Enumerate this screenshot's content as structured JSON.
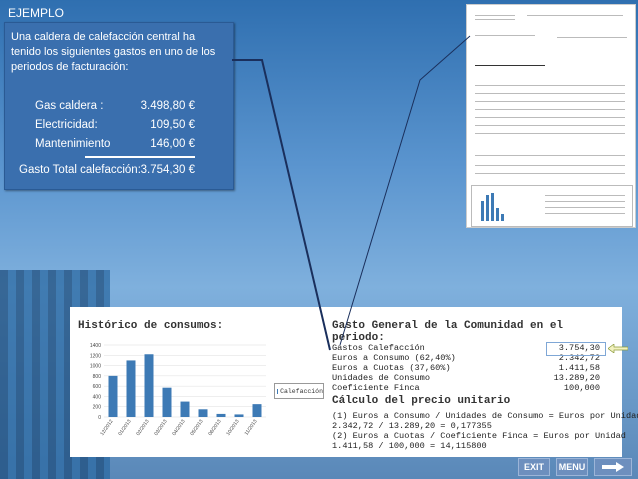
{
  "title": "EJEMPLO",
  "panel": {
    "description": "Una caldera de calefacción central ha tenido los siguientes gastos en uno de los periodos de facturación:",
    "items": [
      {
        "label": "Gas caldera :",
        "amount": "3.498,80 €"
      },
      {
        "label": "Electricidad:",
        "amount": "109,50 €"
      },
      {
        "label": "Mantenimiento",
        "amount": "146,00 €"
      }
    ],
    "total_label": "Gasto Total calefacción:",
    "total_amount": "3.754,30 €"
  },
  "detail": {
    "history_title": "Histórico de consumos:",
    "general_title": "Gasto General de la Comunidad en el periodo:",
    "general": [
      {
        "label": "Gastos Calefacción",
        "value": "3.754,30"
      },
      {
        "label": "Euros a Consumo (62,40%)",
        "value": "2.342,72"
      },
      {
        "label": "Euros a Cuotas (37,60%)",
        "value": "1.411,58"
      },
      {
        "label": "Unidades de Consumo",
        "value": "13.289,20"
      },
      {
        "label": "Coeficiente Finca",
        "value": "100,000"
      }
    ],
    "calc_title": "Cálculo del precio unitario",
    "formula1": "(1) Euros a Consumo / Unidades de Consumo = Euros por Unidad",
    "result1": "2.342,72 / 13.289,20 = 0,177355",
    "formula2": "(2) Euros a Cuotas / Coeficiente Finca = Euros por Unidad",
    "result2": "1.411,58 / 100,000 = 14,115800"
  },
  "chart_data": {
    "type": "bar",
    "categories": [
      "12/2012",
      "01/2013",
      "02/2013",
      "03/2013",
      "04/2013",
      "05/2013",
      "06/2013",
      "10/2013",
      "11/2013"
    ],
    "series": [
      {
        "name": "Calefacción",
        "values": [
          800,
          1100,
          1220,
          570,
          300,
          150,
          60,
          50,
          250
        ]
      }
    ],
    "y_ticks": [
      "1400",
      "1200",
      "1000",
      "800",
      "600",
      "400",
      "200",
      "0"
    ],
    "ylim": [
      0,
      1400
    ],
    "legend": "right"
  },
  "buttons": {
    "exit": "EXIT",
    "menu": "MENU"
  },
  "colors": {
    "panel": "#3a6fae",
    "bar": "#3d7ab5",
    "accent_line": "#1a2f5c"
  }
}
